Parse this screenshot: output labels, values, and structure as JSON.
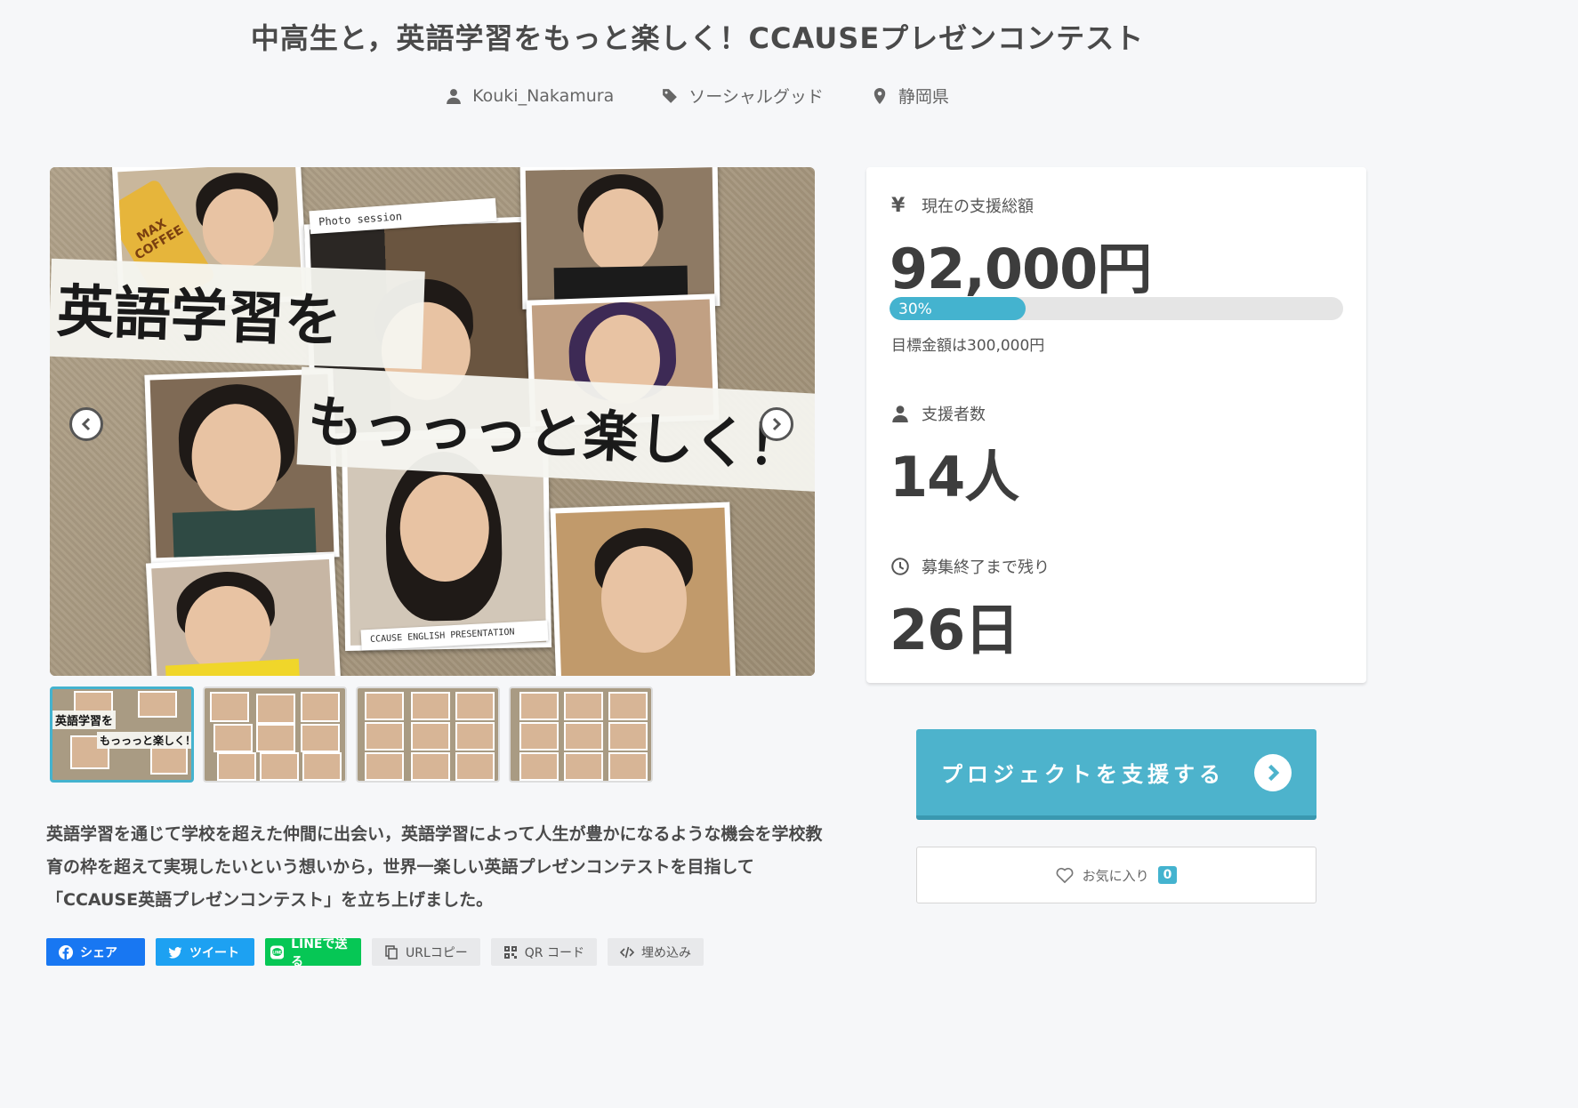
{
  "project": {
    "title": "中高生と，英語学習をもっと楽しく！CCAUSEプレゼンコンテスト",
    "author": "Kouki_Nakamura",
    "category": "ソーシャルグッド",
    "location": "静岡県"
  },
  "hero": {
    "banner_line1": "英語学習を",
    "banner_line2": "もっっっと楽しく！",
    "stamp_top": "Photo session",
    "stamp_bottom": "CCAUSE ENGLISH PRESENTATION",
    "can_label": "MAX COFFEE"
  },
  "thumbnails": {
    "first_line1": "英語学習を",
    "first_line2": "もっっっと楽しく！"
  },
  "description": "英語学習を通じて学校を超えた仲間に出会い，英語学習によって人生が豊かになるような機会を学校教育の枠を超えて実現したいという想いから，世界一楽しい英語プレゼンコンテストを目指して「CCAUSE英語プレゼンコンテスト」を立ち上げました。",
  "share": {
    "facebook": "シェア",
    "twitter": "ツイート",
    "line": "LINEで送る",
    "url_copy": "URLコピー",
    "qr": "QR コード",
    "embed": "埋め込み"
  },
  "stats": {
    "currency_symbol": "¥",
    "total_label": "現在の支援総額",
    "total_value": "92,000円",
    "progress_percent": 30,
    "progress_text": "30%",
    "goal_text": "目標金額は300,000円",
    "supporters_label": "支援者数",
    "supporters_value": "14人",
    "remaining_label": "募集終了まで残り",
    "remaining_value": "26日"
  },
  "actions": {
    "support_label": "プロジェクトを支援する",
    "favorite_label": "お気に入り",
    "favorite_count": "0"
  },
  "colors": {
    "accent": "#44b3cf",
    "facebook": "#1877f2",
    "twitter": "#1da1f2",
    "line": "#06c755"
  }
}
